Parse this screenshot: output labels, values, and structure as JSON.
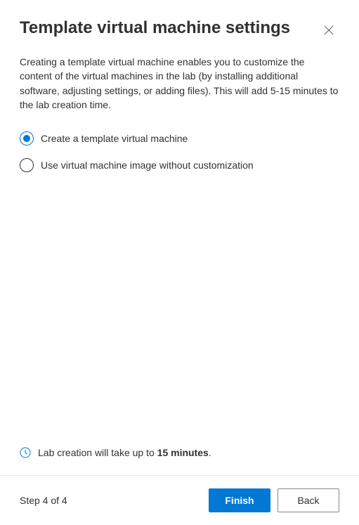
{
  "header": {
    "title": "Template virtual machine settings"
  },
  "description": "Creating a template virtual machine enables you to customize the content of the virtual machines in the lab (by installing additional software, adjusting settings, or adding files). This will add 5-15 minutes to the lab creation time.",
  "options": [
    {
      "label": "Create a template virtual machine",
      "selected": true
    },
    {
      "label": "Use virtual machine image without customization",
      "selected": false
    }
  ],
  "info": {
    "prefix": "Lab creation will take up to ",
    "duration": "15 minutes",
    "suffix": "."
  },
  "footer": {
    "step_label": "Step 4 of 4",
    "finish_label": "Finish",
    "back_label": "Back"
  },
  "colors": {
    "primary": "#0078d4"
  }
}
